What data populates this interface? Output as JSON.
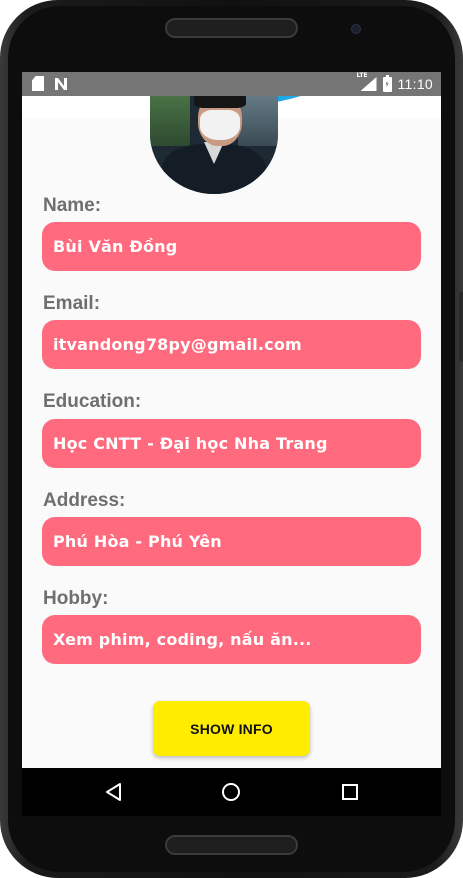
{
  "status_bar": {
    "time": "11:10",
    "network_label": "LTE",
    "left_icons": [
      "sd-card-icon",
      "n-notification-icon"
    ],
    "right_icons": [
      "lte-signal-icon",
      "battery-charging-icon"
    ],
    "background": "#757575"
  },
  "header": {
    "accent_color": "#1fa8e6",
    "avatar_alt": "profile-photo"
  },
  "fields": [
    {
      "key": "name",
      "label": "Name:",
      "value": "Bùi Văn Đồng"
    },
    {
      "key": "email",
      "label": "Email:",
      "value": "itvandong78py@gmail.com"
    },
    {
      "key": "education",
      "label": "Education:",
      "value": "Học CNTT - Đại học Nha Trang"
    },
    {
      "key": "address",
      "label": "Address:",
      "value": "Phú Hòa - Phú Yên"
    },
    {
      "key": "hobby",
      "label": "Hobby:",
      "value": "Xem phim, coding, nấu ăn..."
    }
  ],
  "field_color": "#ff6a7f",
  "action": {
    "label": "SHOW INFO",
    "color": "#ffec00"
  },
  "nav_bar": {
    "items": [
      "back-icon",
      "home-icon",
      "recents-icon"
    ]
  }
}
